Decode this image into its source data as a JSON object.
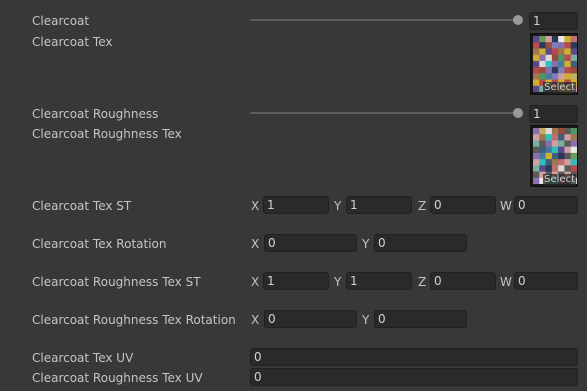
{
  "clearcoat": {
    "label": "Clearcoat",
    "slider_value": 1,
    "value": "1"
  },
  "clearcoat_tex": {
    "label": "Clearcoat Tex",
    "select_label": "Select",
    "thumbnail_icon": "texture-thumbnail"
  },
  "clearcoat_roughness": {
    "label": "Clearcoat Roughness",
    "slider_value": 1,
    "value": "1"
  },
  "clearcoat_roughness_tex": {
    "label": "Clearcoat Roughness Tex",
    "select_label": "Select",
    "thumbnail_icon": "texture-thumbnail"
  },
  "clearcoat_tex_st": {
    "label": "Clearcoat Tex ST",
    "x_label": "X",
    "x": "1",
    "y_label": "Y",
    "y": "1",
    "z_label": "Z",
    "z": "0",
    "w_label": "W",
    "w": "0"
  },
  "clearcoat_tex_rotation": {
    "label": "Clearcoat Tex Rotation",
    "x_label": "X",
    "x": "0",
    "y_label": "Y",
    "y": "0"
  },
  "clearcoat_roughness_tex_st": {
    "label": "Clearcoat Roughness Tex ST",
    "x_label": "X",
    "x": "1",
    "y_label": "Y",
    "y": "1",
    "z_label": "Z",
    "z": "0",
    "w_label": "W",
    "w": "0"
  },
  "clearcoat_roughness_tex_rotation": {
    "label": "Clearcoat Roughness Tex Rotation",
    "x_label": "X",
    "x": "0",
    "y_label": "Y",
    "y": "0"
  },
  "clearcoat_tex_uv": {
    "label": "Clearcoat Tex UV",
    "value": "0"
  },
  "clearcoat_roughness_tex_uv": {
    "label": "Clearcoat Roughness Tex UV",
    "value": "0"
  },
  "colors": {
    "background": "#383838",
    "field_bg": "#2a2a2a",
    "text": "#c4c4c4",
    "slider_thumb": "#999999"
  }
}
